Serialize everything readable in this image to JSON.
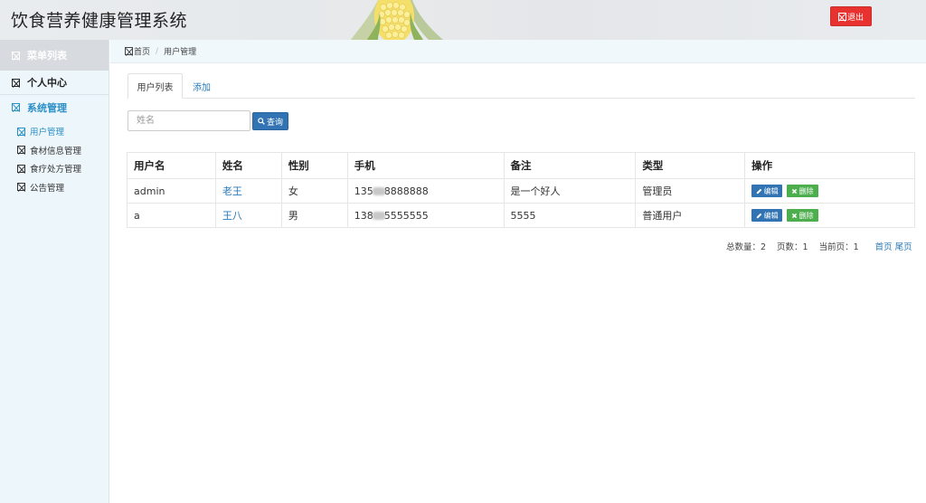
{
  "header": {
    "app_title": "饮食营养健康管理系统",
    "logout_label": "退出",
    "colors": {
      "logout_bg": "#e8322f"
    }
  },
  "sidebar": {
    "heading": "菜单列表",
    "sections": [
      {
        "label": "个人中心"
      },
      {
        "label": "系统管理"
      }
    ],
    "items": [
      {
        "label": "用户管理",
        "active": true
      },
      {
        "label": "食材信息管理"
      },
      {
        "label": "食疗处方管理"
      },
      {
        "label": "公告管理"
      }
    ]
  },
  "breadcrumb": {
    "home": "首页",
    "separator": "/",
    "current": "用户管理"
  },
  "tabs": [
    {
      "label": "用户列表",
      "active": true
    },
    {
      "label": "添加"
    }
  ],
  "search": {
    "placeholder": "姓名",
    "value": "",
    "button_label": "查询",
    "button_icon": "search-icon"
  },
  "table": {
    "columns": [
      "用户名",
      "姓名",
      "性别",
      "手机",
      "备注",
      "类型",
      "操作"
    ],
    "rows": [
      {
        "username": "admin",
        "name": "老王",
        "gender": "女",
        "phone_start": "135",
        "phone_end": "8888888",
        "note": "是一个好人",
        "type": "管理员"
      },
      {
        "username": "a",
        "name": "王八",
        "gender": "男",
        "phone_start": "138",
        "phone_end": "5555555",
        "note": "5555",
        "type": "普通用户"
      }
    ],
    "edit_label": "编辑",
    "delete_label": "删除"
  },
  "pager": {
    "total": "总数量：2",
    "pages": "页数：1",
    "current": "当前页：1",
    "first": "首页",
    "last": "尾页"
  }
}
